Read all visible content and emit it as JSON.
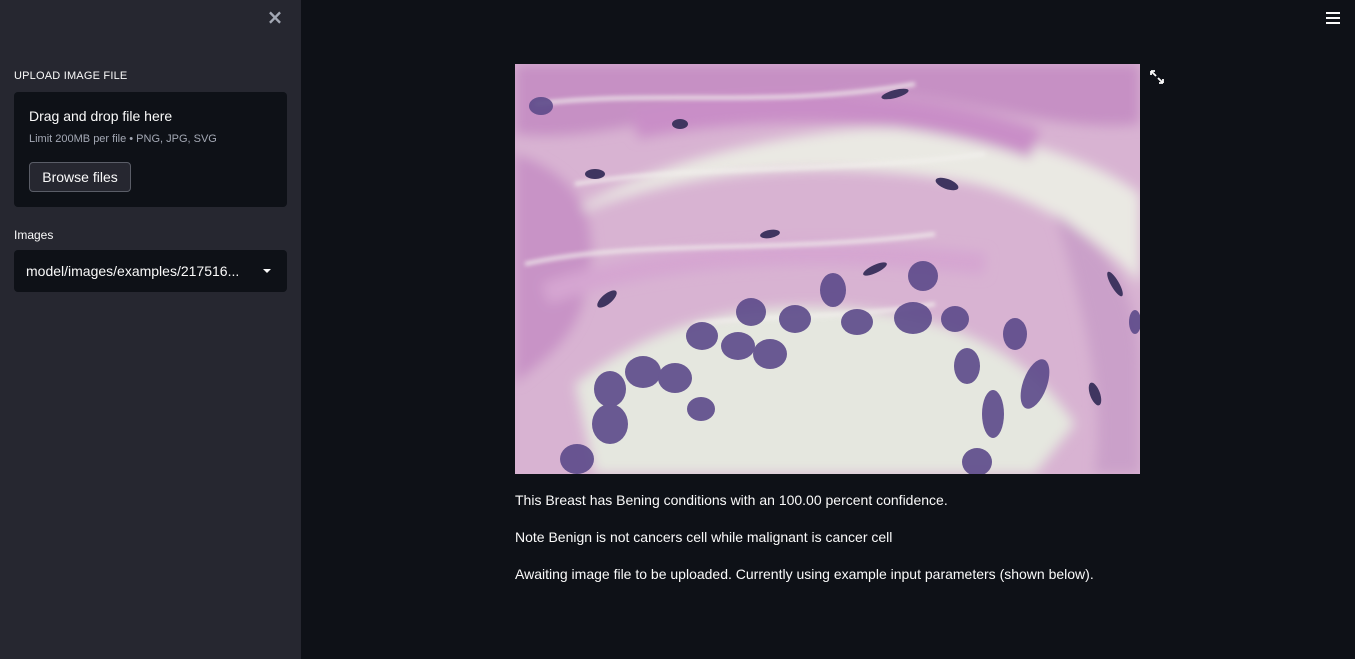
{
  "sidebar": {
    "upload_label": "UPLOAD IMAGE FILE",
    "dropzone": {
      "title": "Drag and drop file here",
      "limit": "Limit 200MB per file • PNG, JPG, SVG",
      "browse_label": "Browse files"
    },
    "images_label": "Images",
    "images_select_value": "model/images/examples/217516..."
  },
  "main": {
    "result_text": "This Breast has Bening conditions with an 100.00 percent confidence.",
    "note_text": "Note Benign is not cancers cell while malignant is cancer cell",
    "awaiting_text": "Awaiting image file to be uploaded. Currently using example input parameters (shown below)."
  },
  "icons": {
    "close": "close-icon",
    "menu": "hamburger-menu-icon",
    "fullscreen": "fullscreen-expand-icon",
    "dropdown": "chevron-down-icon"
  },
  "colors": {
    "background": "#0e1117",
    "sidebar": "#262730",
    "text": "#fafafa",
    "muted_text": "#a3a8b4"
  }
}
